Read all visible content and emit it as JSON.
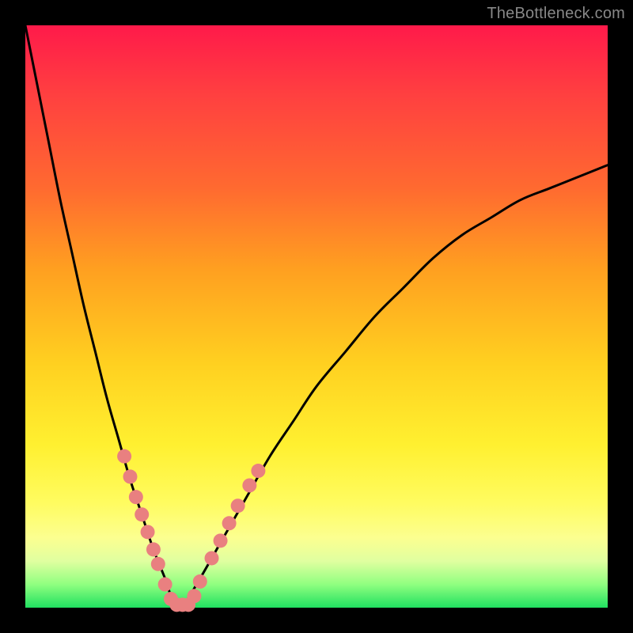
{
  "watermark": "TheBottleneck.com",
  "chart_data": {
    "type": "line",
    "title": "",
    "xlabel": "",
    "ylabel": "",
    "xlim": [
      0,
      100
    ],
    "ylim": [
      0,
      100
    ],
    "grid": false,
    "legend": false,
    "background": "rainbow-gradient-red-to-green",
    "series": [
      {
        "name": "left-curve",
        "color": "#000000",
        "x": [
          0,
          2,
          4,
          6,
          8,
          10,
          12,
          14,
          16,
          18,
          20,
          22,
          24,
          25,
          26,
          27
        ],
        "y": [
          100,
          90,
          80,
          70,
          61,
          52,
          44,
          36,
          29,
          22,
          16,
          10,
          5,
          2,
          0,
          0
        ]
      },
      {
        "name": "right-curve",
        "color": "#000000",
        "x": [
          27,
          30,
          34,
          38,
          42,
          46,
          50,
          55,
          60,
          65,
          70,
          75,
          80,
          85,
          90,
          95,
          100
        ],
        "y": [
          0,
          5,
          12,
          19,
          26,
          32,
          38,
          44,
          50,
          55,
          60,
          64,
          67,
          70,
          72,
          74,
          76
        ]
      }
    ],
    "markers": [
      {
        "x": 17.0,
        "y": 26.0
      },
      {
        "x": 18.0,
        "y": 22.5
      },
      {
        "x": 19.0,
        "y": 19.0
      },
      {
        "x": 20.0,
        "y": 16.0
      },
      {
        "x": 21.0,
        "y": 13.0
      },
      {
        "x": 22.0,
        "y": 10.0
      },
      {
        "x": 22.8,
        "y": 7.5
      },
      {
        "x": 24.0,
        "y": 4.0
      },
      {
        "x": 25.0,
        "y": 1.5
      },
      {
        "x": 26.0,
        "y": 0.5
      },
      {
        "x": 27.0,
        "y": 0.5
      },
      {
        "x": 28.0,
        "y": 0.5
      },
      {
        "x": 29.0,
        "y": 2.0
      },
      {
        "x": 30.0,
        "y": 4.5
      },
      {
        "x": 32.0,
        "y": 8.5
      },
      {
        "x": 33.5,
        "y": 11.5
      },
      {
        "x": 35.0,
        "y": 14.5
      },
      {
        "x": 36.5,
        "y": 17.5
      },
      {
        "x": 38.5,
        "y": 21.0
      },
      {
        "x": 40.0,
        "y": 23.5
      }
    ],
    "marker_style": {
      "color": "#e98080",
      "radius_px": 9,
      "shape": "circle"
    },
    "curve_stroke_px": 3
  }
}
